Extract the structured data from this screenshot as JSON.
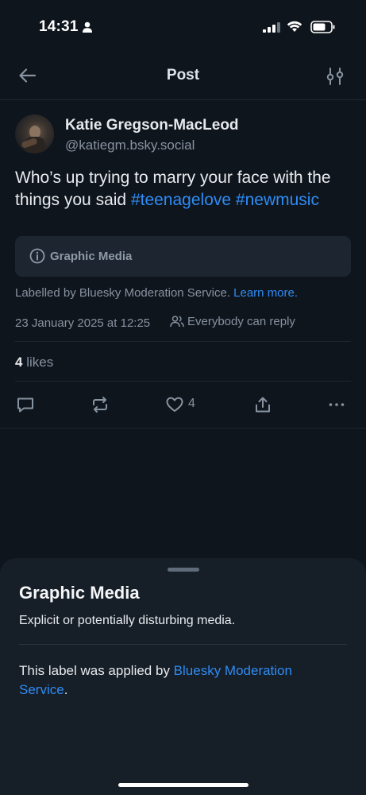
{
  "status_bar": {
    "time": "14:31",
    "icons": [
      "person-icon",
      "cellular-signal-icon",
      "wifi-icon",
      "battery-icon"
    ]
  },
  "header": {
    "title": "Post",
    "back_icon": "arrow-left-icon",
    "settings_icon": "sliders-icon"
  },
  "post": {
    "author_name": "Katie Gregson-MacLeod",
    "author_handle": "@katiegm.bsky.social",
    "text_prefix": "Who’s up trying to marry your face with the things you said ",
    "hashtags": [
      "#teenagelove",
      "#newmusic"
    ],
    "media_warning": "Graphic Media",
    "labelled_by_text": "Labelled by Bluesky Moderation Service.",
    "learn_more": "Learn more.",
    "timestamp": "23 January 2025 at 12:25",
    "reply_setting": "Everybody can reply",
    "likes_count": "4",
    "likes_label": "likes",
    "action_like_count": "4"
  },
  "sheet": {
    "title": "Graphic Media",
    "description": "Explicit or potentially disturbing media.",
    "applied_prefix": "This label was applied by ",
    "applied_link": "Bluesky Moderation Service",
    "applied_suffix": "."
  },
  "colors": {
    "background": "#0f151c",
    "accent": "#2f8cf5",
    "muted_text": "#8793a1",
    "sheet_background": "#161e27"
  }
}
